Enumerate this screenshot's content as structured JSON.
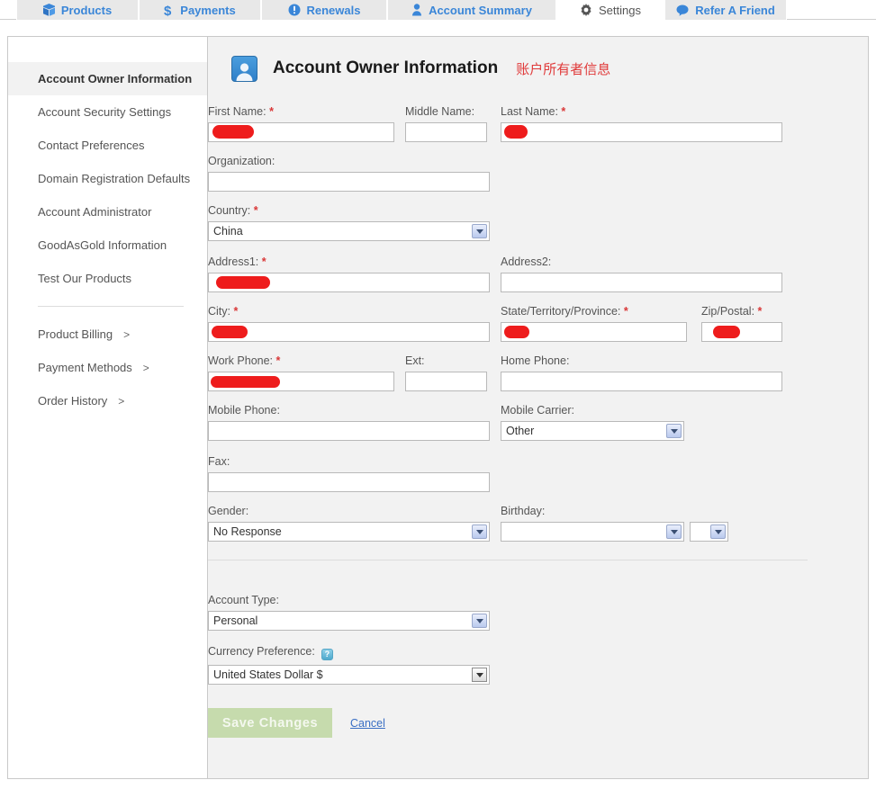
{
  "tabs": [
    {
      "label": "Products",
      "icon": "box-icon",
      "active": false
    },
    {
      "label": "Payments",
      "icon": "dollar-icon",
      "active": false
    },
    {
      "label": "Renewals",
      "icon": "refresh-icon",
      "active": false
    },
    {
      "label": "Account Summary",
      "icon": "person-icon",
      "active": false
    },
    {
      "label": "Settings",
      "icon": "gear-icon",
      "active": true
    },
    {
      "label": "Refer A Friend",
      "icon": "speech-bubble-icon",
      "active": false
    }
  ],
  "sidebar": {
    "items": [
      {
        "label": "Account Owner Information",
        "active": true
      },
      {
        "label": "Account Security Settings",
        "active": false
      },
      {
        "label": "Contact Preferences",
        "active": false
      },
      {
        "label": "Domain Registration Defaults",
        "active": false
      },
      {
        "label": "Account Administrator",
        "active": false
      },
      {
        "label": "GoodAsGold Information",
        "active": false
      },
      {
        "label": "Test Our Products",
        "active": false
      }
    ],
    "sub_items": [
      {
        "label": "Product Billing",
        "arrow": ">"
      },
      {
        "label": "Payment Methods",
        "arrow": ">"
      },
      {
        "label": "Order History",
        "arrow": ">"
      }
    ]
  },
  "header": {
    "title": "Account Owner Information",
    "title_cn": "账户所有者信息",
    "icon": "account-owner-avatar-icon"
  },
  "form": {
    "first_name": {
      "label": "First Name:",
      "required": true,
      "value": "",
      "redacted": true
    },
    "middle_name": {
      "label": "Middle Name:",
      "required": false,
      "value": ""
    },
    "last_name": {
      "label": "Last Name:",
      "required": true,
      "value": "",
      "redacted": true
    },
    "organization": {
      "label": "Organization:",
      "required": false,
      "value": ""
    },
    "country": {
      "label": "Country:",
      "required": true,
      "value": "China"
    },
    "address1": {
      "label": "Address1:",
      "required": true,
      "value": "",
      "redacted": true
    },
    "address2": {
      "label": "Address2:",
      "required": false,
      "value": ""
    },
    "city": {
      "label": "City:",
      "required": true,
      "value": "",
      "redacted": true
    },
    "state": {
      "label": "State/Territory/Province:",
      "required": true,
      "value": "",
      "redacted": true
    },
    "zip": {
      "label": "Zip/Postal:",
      "required": true,
      "value": "",
      "redacted": true
    },
    "work_phone": {
      "label": "Work Phone:",
      "required": true,
      "value": "",
      "redacted": true
    },
    "ext": {
      "label": "Ext:",
      "required": false,
      "value": ""
    },
    "home_phone": {
      "label": "Home Phone:",
      "required": false,
      "value": ""
    },
    "mobile_phone": {
      "label": "Mobile Phone:",
      "required": false,
      "value": ""
    },
    "mobile_carrier": {
      "label": "Mobile Carrier:",
      "required": false,
      "value": "Other"
    },
    "fax": {
      "label": "Fax:",
      "required": false,
      "value": ""
    },
    "gender": {
      "label": "Gender:",
      "required": false,
      "value": "No Response"
    },
    "birthday": {
      "label": "Birthday:",
      "required": false,
      "value_month": "",
      "value_year": ""
    },
    "account_type": {
      "label": "Account Type:",
      "required": false,
      "value": "Personal"
    },
    "currency": {
      "label": "Currency Preference:",
      "required": false,
      "value": "United States Dollar $",
      "help_icon": "question-mark-icon",
      "help_glyph": "?"
    }
  },
  "actions": {
    "save_label": "Save Changes",
    "cancel_label": "Cancel"
  },
  "colors": {
    "tab_link": "#3a86d8",
    "required_star": "#d93838",
    "title_cn": "#e03a3a",
    "save_button": "#c6dbad",
    "redaction": "#ee1c1c"
  }
}
